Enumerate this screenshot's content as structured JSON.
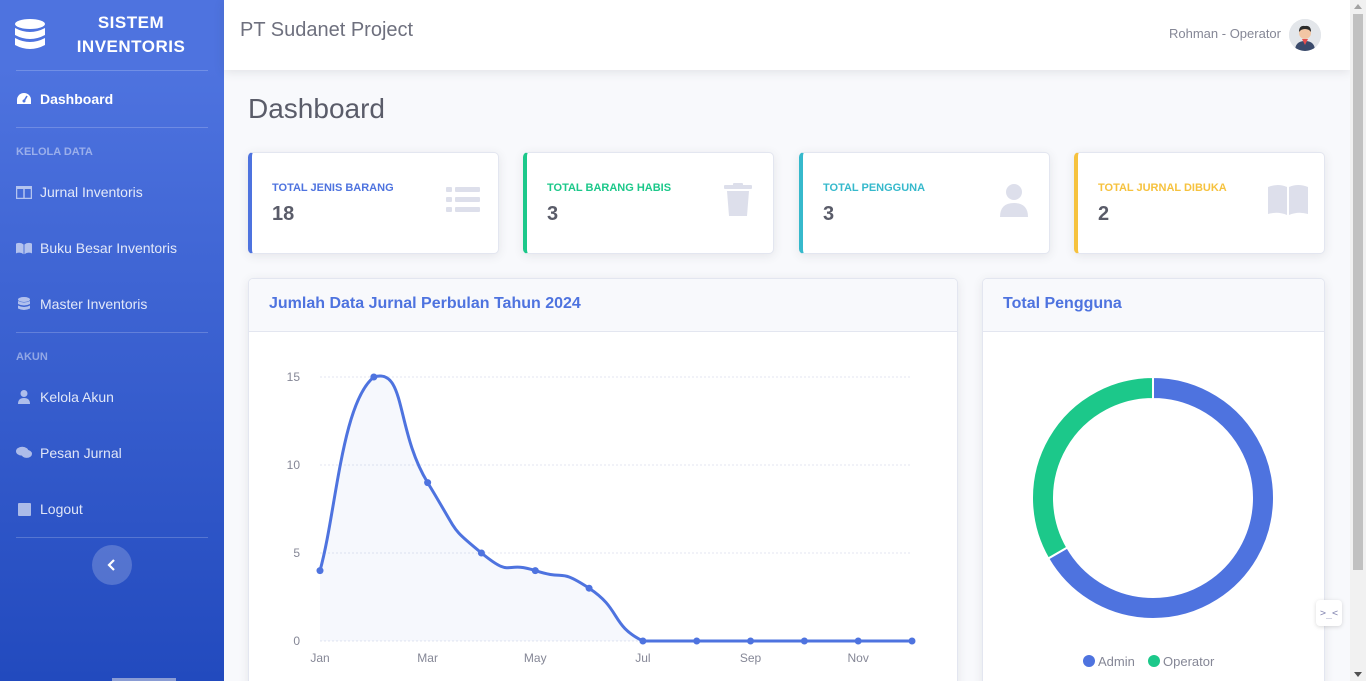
{
  "brand": {
    "line1": "SISTEM",
    "line2": "INVENTORIS",
    "icon": "database-icon"
  },
  "sidebar": {
    "dashboard": {
      "label": "Dashboard",
      "icon": "tachometer-icon"
    },
    "heading_kelola": "KELOLA DATA",
    "items_kelola": [
      {
        "label": "Jurnal Inventoris",
        "icon": "columns-icon"
      },
      {
        "label": "Buku Besar Inventoris",
        "icon": "book-open-icon"
      },
      {
        "label": "Master Inventoris",
        "icon": "database-icon"
      }
    ],
    "heading_akun": "AKUN",
    "items_akun": [
      {
        "label": "Kelola Akun",
        "icon": "user-icon"
      },
      {
        "label": "Pesan Jurnal",
        "icon": "comments-icon"
      },
      {
        "label": "Logout",
        "icon": "square-icon"
      }
    ],
    "toggle_icon": "chevron-left-icon"
  },
  "topbar": {
    "project": "PT Sudanet Project",
    "user": "Rohman - Operator"
  },
  "page": {
    "title": "Dashboard"
  },
  "stats": [
    {
      "label": "TOTAL JENIS BARANG",
      "value": "18",
      "color": "#4e73df",
      "icon": "list-icon"
    },
    {
      "label": "TOTAL BARANG HABIS",
      "value": "3",
      "color": "#1cc88a",
      "icon": "trash-icon"
    },
    {
      "label": "TOTAL PENGGUNA",
      "value": "3",
      "color": "#36b9cc",
      "icon": "user-icon"
    },
    {
      "label": "TOTAL JURNAL DIBUKA",
      "value": "2",
      "color": "#f6c23e",
      "icon": "book-open-icon"
    }
  ],
  "line_card": {
    "title": "Jumlah Data Jurnal Perbulan Tahun 2024"
  },
  "pie_card": {
    "title": "Total Pengguna"
  },
  "chart_data": [
    {
      "type": "line",
      "title": "Jumlah Data Jurnal Perbulan Tahun 2024",
      "x": [
        "Jan",
        "Feb",
        "Mar",
        "Apr",
        "May",
        "Jun",
        "Jul",
        "Aug",
        "Sep",
        "Oct",
        "Nov",
        "Dec"
      ],
      "x_tick_labels": [
        "Jan",
        "Mar",
        "May",
        "Jul",
        "Sep",
        "Nov"
      ],
      "series": [
        {
          "values": [
            4,
            15,
            9,
            5,
            4,
            3,
            0,
            0,
            0,
            0,
            0,
            0
          ],
          "color": "#4e73df"
        }
      ],
      "ylim": [
        0,
        15
      ],
      "y_ticks": [
        0,
        5,
        10,
        15
      ],
      "grid": true
    },
    {
      "type": "pie",
      "title": "Total Pengguna",
      "categories": [
        "Admin",
        "Operator"
      ],
      "values": [
        2,
        1
      ],
      "colors": [
        "#4e73df",
        "#1cc88a"
      ],
      "legend": "bottom"
    }
  ],
  "floating_button": {
    "text": ">_<"
  }
}
